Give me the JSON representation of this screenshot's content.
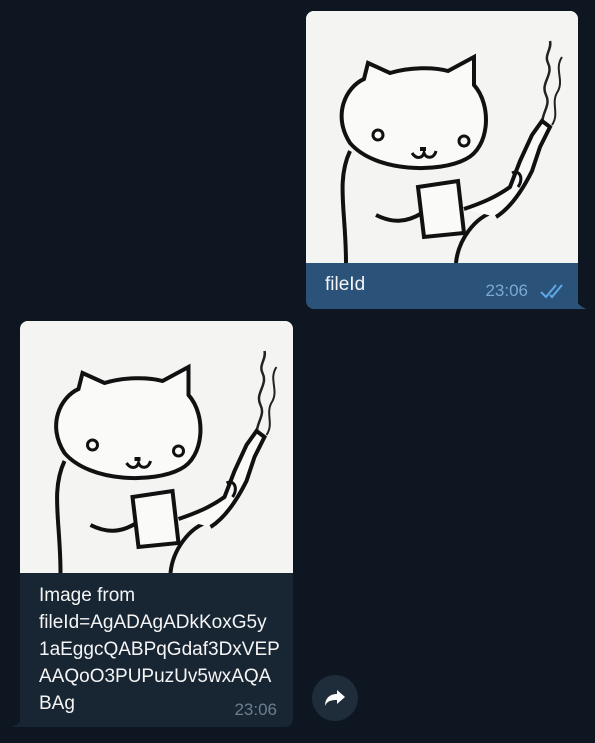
{
  "chat": {
    "outgoing": {
      "caption": "fileId",
      "time": "23:06",
      "status_icon": "double-check-icon",
      "image_icon": "cat-with-gun-sticker"
    },
    "incoming": {
      "caption": "Image from\nfileId=AgADAgADkKoxG5y\n1aEggcQABPqGdaf3DxVEP\nAAQoO3PUPuzUv5wxAQA\nBAg",
      "time": "23:06",
      "image_icon": "cat-with-gun-sticker"
    },
    "forward_icon": "forward-arrow-icon",
    "colors": {
      "background": "#0e1621",
      "outgoing_bubble": "#2b5278",
      "incoming_bubble": "#182533",
      "read_check": "#5ea8e8"
    }
  }
}
